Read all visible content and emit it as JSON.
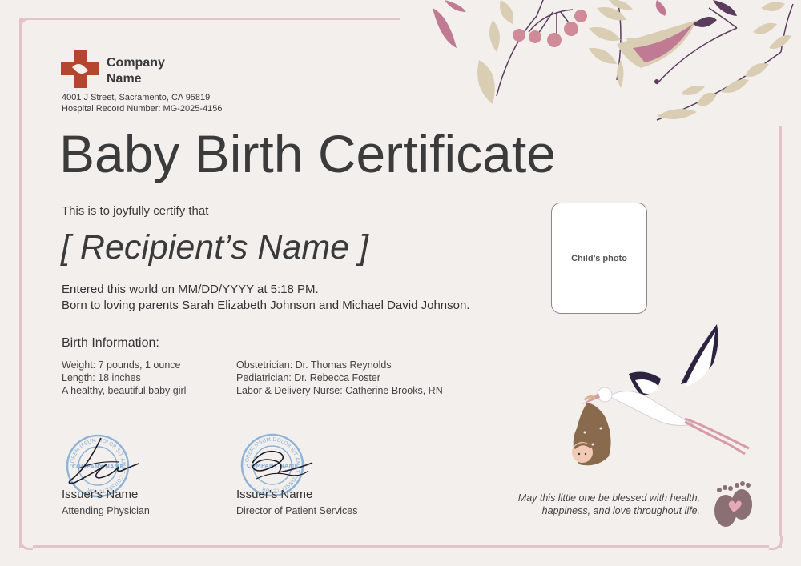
{
  "company": {
    "name": "Company Name",
    "address": "4001 J Street, Sacramento, CA 95819",
    "record": "Hospital Record Number: MG-2025-4156"
  },
  "certificate": {
    "title": "Baby Birth Certificate",
    "intro": "This is to joyfully certify that",
    "recipient": "[ Recipient’s Name ]",
    "entered_line": "Entered this world on MM/DD/YYYY at 5:18 PM.",
    "parents_line": "Born to loving parents Sarah Elizabeth Johnson and Michael David Johnson."
  },
  "photo": {
    "label": "Child’s photo"
  },
  "birth_info": {
    "heading": "Birth Information:",
    "left": [
      "Weight: 7 pounds, 1 ounce",
      "Length: 18 inches",
      "A healthy, beautiful baby girl"
    ],
    "right": [
      "Obstetrician: Dr. Thomas Reynolds",
      "Pediatrician: Dr. Rebecca Foster",
      "Labor & Delivery Nurse: Catherine Brooks, RN"
    ]
  },
  "issuers": [
    {
      "name": "Issuer's Name",
      "role": "Attending Physician"
    },
    {
      "name": "Issuer's Name",
      "role": "Director of Patient Services"
    }
  ],
  "seal": {
    "ring_text": "LOREM IPSUM DOLOR SIT AMET CONSECTETUR",
    "center_text": "COMPANY NAME"
  },
  "blessing": {
    "line1": "May this little one be blessed with health,",
    "line2": "happiness, and love throughout life."
  },
  "colors": {
    "background": "#f3efec",
    "frame": "#e3c3c9",
    "logo": "#b5452e",
    "leaf_mauve": "#c07a93",
    "leaf_beige": "#d9cdb4",
    "berry": "#cf8b98",
    "stamp_blue": "#8fb3d6"
  }
}
